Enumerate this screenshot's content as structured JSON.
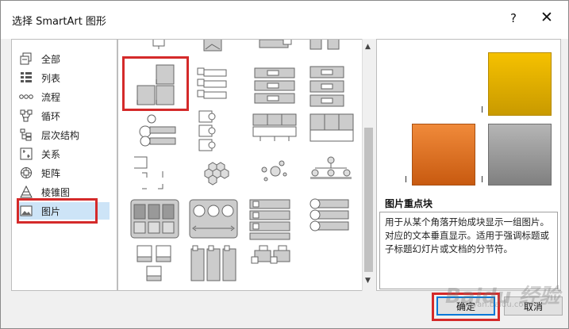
{
  "dialog": {
    "title": "选择 SmartArt 图形",
    "help": "?",
    "close": "✕"
  },
  "categories": [
    {
      "label": "全部",
      "icon": "all-icon"
    },
    {
      "label": "列表",
      "icon": "list-icon"
    },
    {
      "label": "流程",
      "icon": "process-icon"
    },
    {
      "label": "循环",
      "icon": "cycle-icon"
    },
    {
      "label": "层次结构",
      "icon": "hierarchy-icon"
    },
    {
      "label": "关系",
      "icon": "relationship-icon"
    },
    {
      "label": "矩阵",
      "icon": "matrix-icon"
    },
    {
      "label": "棱锥图",
      "icon": "pyramid-icon"
    },
    {
      "label": "图片",
      "icon": "picture-icon"
    }
  ],
  "selected_category": "图片",
  "preview": {
    "name": "图片重点块",
    "description": "用于从某个角落开始成块显示一组图片。对应的文本垂直显示。适用于强调标题或子标题幻灯片或文档的分节符。",
    "colors": {
      "top": "#f0b800",
      "left": "#e8701e",
      "right": "#9a9a9a"
    }
  },
  "buttons": {
    "ok": "确定",
    "cancel": "取消"
  },
  "watermark": {
    "main": "Baidu 经验",
    "sub": "jingyan.baidu.com"
  },
  "accent": {
    "selection": "#cde4f7",
    "highlight": "#d42a2a",
    "focus": "#0078d7"
  }
}
